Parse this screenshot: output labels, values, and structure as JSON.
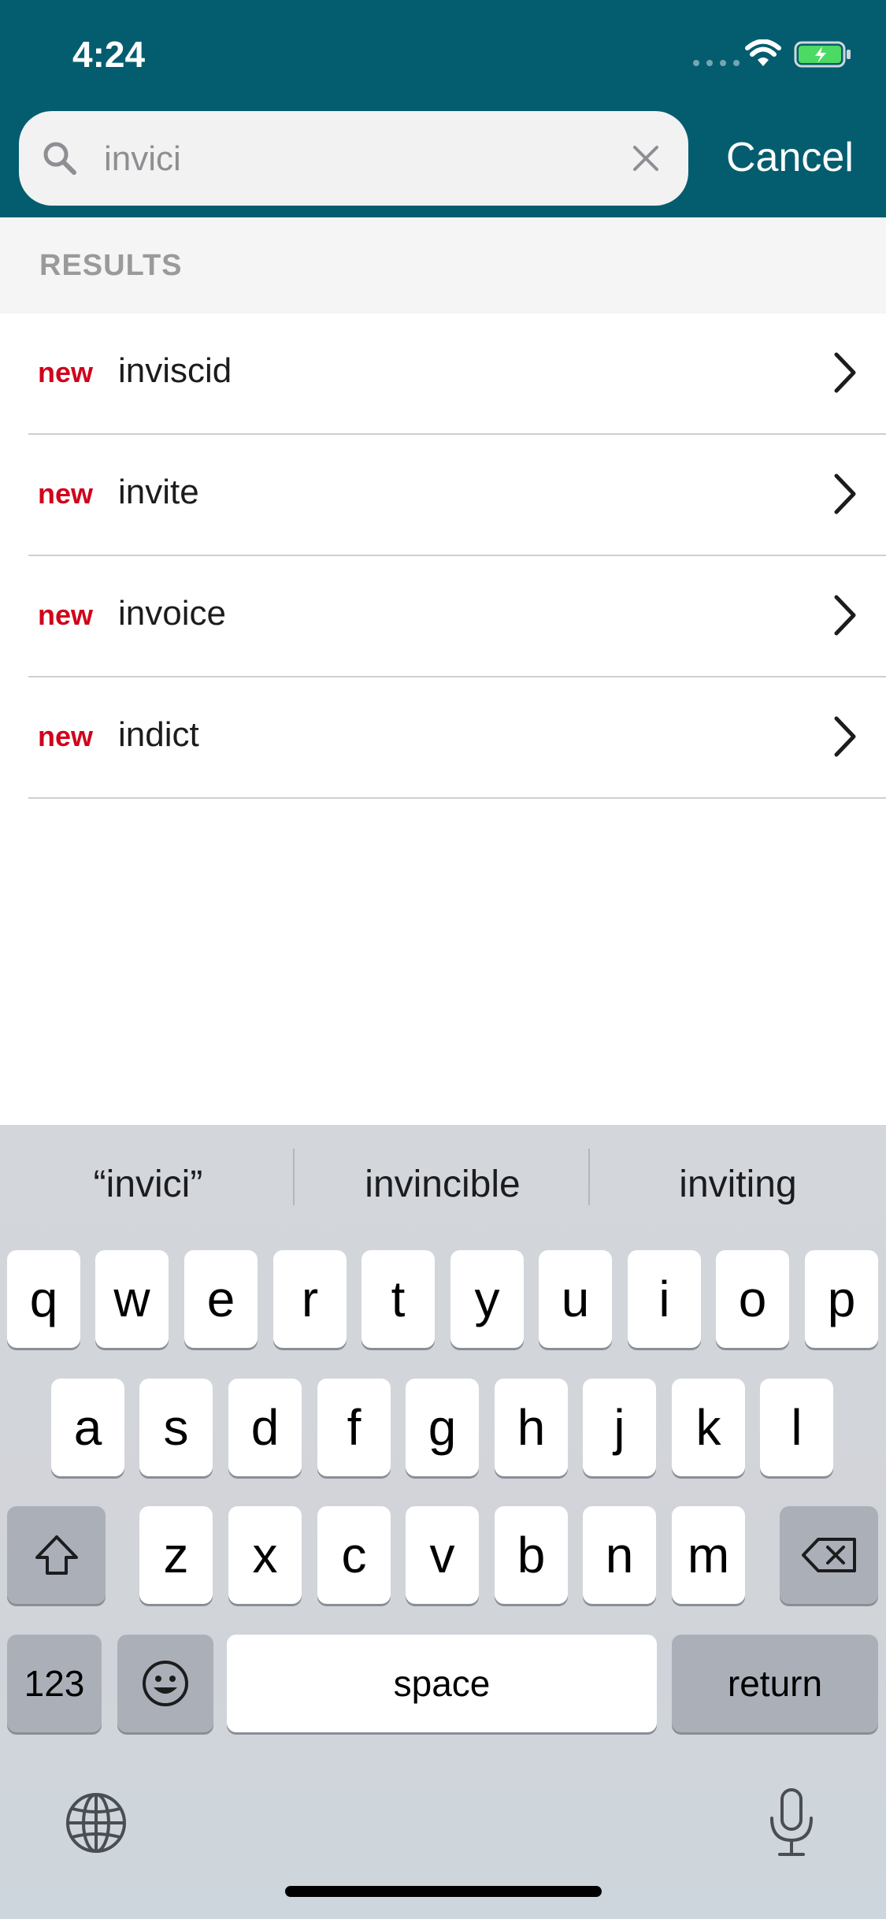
{
  "status": {
    "time": "4:24"
  },
  "search": {
    "query": "invici",
    "cancel_label": "Cancel"
  },
  "results": {
    "section_label": "RESULTS",
    "items": [
      {
        "badge": "new",
        "word": "inviscid"
      },
      {
        "badge": "new",
        "word": "invite"
      },
      {
        "badge": "new",
        "word": "invoice"
      },
      {
        "badge": "new",
        "word": "indict"
      }
    ]
  },
  "keyboard": {
    "suggestions": [
      "“invici”",
      "invincible",
      "inviting"
    ],
    "row1": [
      "q",
      "w",
      "e",
      "r",
      "t",
      "y",
      "u",
      "i",
      "o",
      "p"
    ],
    "row2": [
      "a",
      "s",
      "d",
      "f",
      "g",
      "h",
      "j",
      "k",
      "l"
    ],
    "row3": [
      "z",
      "x",
      "c",
      "v",
      "b",
      "n",
      "m"
    ],
    "numbers_label": "123",
    "space_label": "space",
    "return_label": "return"
  },
  "colors": {
    "header": "#045d6f",
    "badge": "#d0021b",
    "battery": "#4cd964"
  }
}
